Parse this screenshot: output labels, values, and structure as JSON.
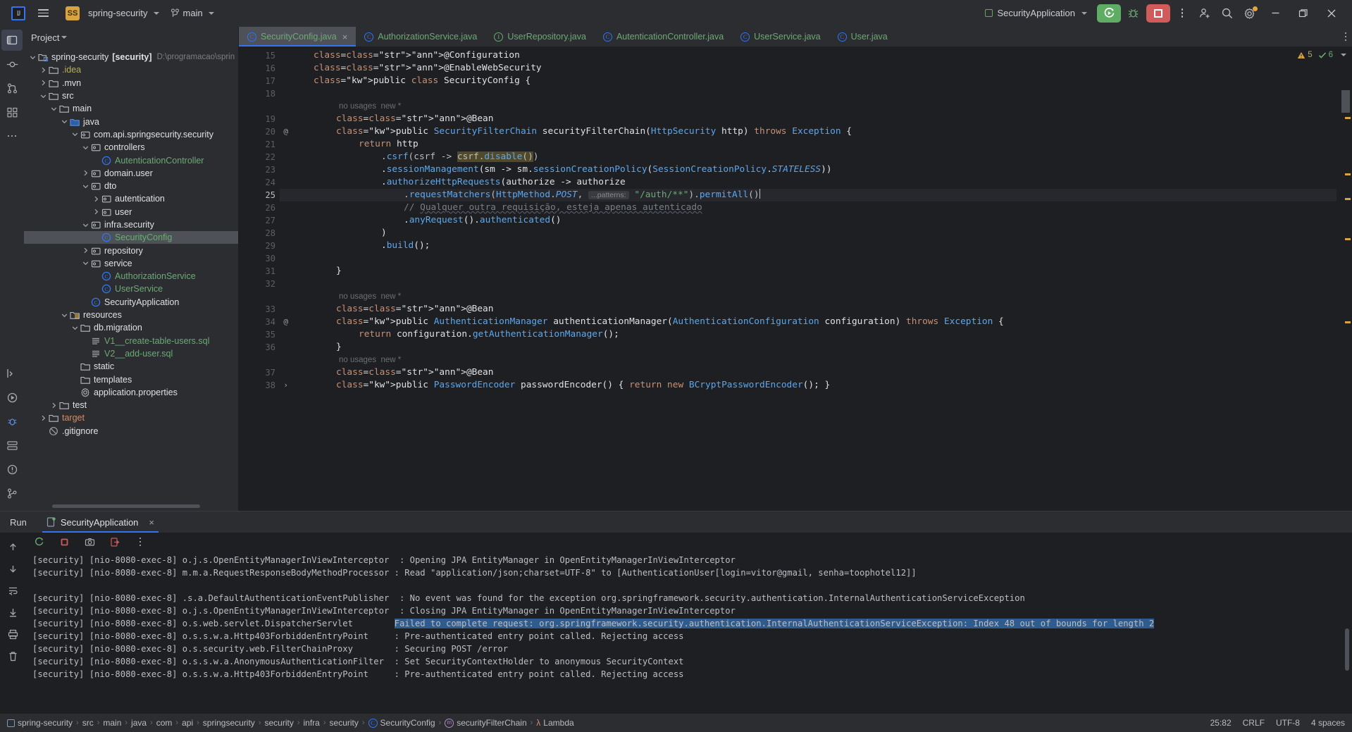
{
  "titlebar": {
    "logo": "IJ",
    "menu_icon": "hamburger-icon",
    "project_badge": "SS",
    "project_name": "spring-security",
    "branch_icon": "git-branch-icon",
    "branch_name": "main",
    "run_config": "SecurityApplication",
    "run_icon": "run-icon",
    "debug_icon": "debug-bug-icon",
    "stop_icon": "stop-icon",
    "more_icon": "more-vertical-icon",
    "account_icon": "add-account-icon",
    "search_icon": "search-icon",
    "settings_icon": "gear-icon",
    "minimize_icon": "minimize-icon",
    "maximize_icon": "maximize-icon",
    "close_icon": "close-icon"
  },
  "rail": {
    "top": [
      "project-icon",
      "commit-icon",
      "pull-requests-icon",
      "structure-icon",
      "more-tools-icon"
    ],
    "bottom": [
      "terminal-icon",
      "run-icon",
      "debug-icon",
      "services-icon",
      "problems-icon",
      "git-icon"
    ]
  },
  "project_panel": {
    "title": "Project",
    "tree": [
      {
        "depth": 0,
        "twist": "open",
        "icon": "module-icon",
        "label": "spring-security",
        "bold": "[security]",
        "path": "D:\\programacao\\sprin",
        "style": "plain"
      },
      {
        "depth": 1,
        "twist": "closed",
        "icon": "folder-icon",
        "label": ".idea",
        "style": "khaki"
      },
      {
        "depth": 1,
        "twist": "closed",
        "icon": "folder-icon",
        "label": ".mvn",
        "style": "plain"
      },
      {
        "depth": 1,
        "twist": "open",
        "icon": "folder-icon",
        "label": "src",
        "style": "plain"
      },
      {
        "depth": 2,
        "twist": "open",
        "icon": "folder-icon",
        "label": "main",
        "style": "plain"
      },
      {
        "depth": 3,
        "twist": "open",
        "icon": "source-folder-icon",
        "label": "java",
        "style": "plain"
      },
      {
        "depth": 4,
        "twist": "open",
        "icon": "package-icon",
        "label": "com.api.springsecurity.security",
        "style": "plain"
      },
      {
        "depth": 5,
        "twist": "open",
        "icon": "package-icon",
        "label": "controllers",
        "style": "plain"
      },
      {
        "depth": 6,
        "twist": "none",
        "icon": "java-class-icon",
        "label": "AutenticationController",
        "style": "green"
      },
      {
        "depth": 5,
        "twist": "closed",
        "icon": "package-icon",
        "label": "domain.user",
        "style": "plain"
      },
      {
        "depth": 5,
        "twist": "open",
        "icon": "package-icon",
        "label": "dto",
        "style": "plain"
      },
      {
        "depth": 6,
        "twist": "closed",
        "icon": "package-icon",
        "label": "autentication",
        "style": "plain"
      },
      {
        "depth": 6,
        "twist": "closed",
        "icon": "package-icon",
        "label": "user",
        "style": "plain"
      },
      {
        "depth": 5,
        "twist": "open",
        "icon": "package-icon",
        "label": "infra.security",
        "style": "plain"
      },
      {
        "depth": 6,
        "twist": "none",
        "icon": "java-class-icon",
        "label": "SecurityConfig",
        "style": "green",
        "selected": true
      },
      {
        "depth": 5,
        "twist": "closed",
        "icon": "package-icon",
        "label": "repository",
        "style": "plain"
      },
      {
        "depth": 5,
        "twist": "open",
        "icon": "package-icon",
        "label": "service",
        "style": "plain"
      },
      {
        "depth": 6,
        "twist": "none",
        "icon": "java-class-icon",
        "label": "AuthorizationService",
        "style": "green"
      },
      {
        "depth": 6,
        "twist": "none",
        "icon": "java-class-icon",
        "label": "UserService",
        "style": "green"
      },
      {
        "depth": 5,
        "twist": "none",
        "icon": "java-class-icon",
        "label": "SecurityApplication",
        "style": "plain"
      },
      {
        "depth": 3,
        "twist": "open",
        "icon": "resources-folder-icon",
        "label": "resources",
        "style": "plain"
      },
      {
        "depth": 4,
        "twist": "open",
        "icon": "folder-icon",
        "label": "db.migration",
        "style": "plain"
      },
      {
        "depth": 5,
        "twist": "none",
        "icon": "sql-file-icon",
        "label": "V1__create-table-users.sql",
        "style": "green"
      },
      {
        "depth": 5,
        "twist": "none",
        "icon": "sql-file-icon",
        "label": "V2__add-user.sql",
        "style": "green"
      },
      {
        "depth": 4,
        "twist": "none",
        "icon": "folder-icon",
        "label": "static",
        "style": "plain"
      },
      {
        "depth": 4,
        "twist": "none",
        "icon": "folder-icon",
        "label": "templates",
        "style": "plain"
      },
      {
        "depth": 4,
        "twist": "none",
        "icon": "properties-file-icon",
        "label": "application.properties",
        "style": "plain"
      },
      {
        "depth": 2,
        "twist": "closed",
        "icon": "folder-icon",
        "label": "test",
        "style": "plain"
      },
      {
        "depth": 1,
        "twist": "closed",
        "icon": "folder-icon",
        "label": "target",
        "style": "orange"
      },
      {
        "depth": 1,
        "twist": "none",
        "icon": "gitignore-icon",
        "label": ".gitignore",
        "style": "plain"
      }
    ]
  },
  "editor": {
    "tabs": [
      {
        "label": "SecurityConfig.java",
        "icon": "java-class-icon",
        "active": true,
        "closable": true
      },
      {
        "label": "AuthorizationService.java",
        "icon": "java-class-icon",
        "active": false
      },
      {
        "label": "UserRepository.java",
        "icon": "java-interface-icon",
        "active": false
      },
      {
        "label": "AutenticationController.java",
        "icon": "java-class-icon",
        "active": false
      },
      {
        "label": "UserService.java",
        "icon": "java-class-icon",
        "active": false
      },
      {
        "label": "User.java",
        "icon": "java-class-icon",
        "active": false
      }
    ],
    "more_tabs_icon": "more-vertical-icon",
    "analysis": {
      "warnings": "5",
      "ok": "6",
      "warn_icon": "warning-triangle-icon",
      "ok_icon": "checkmark-icon",
      "collapse_icon": "chevron-down-icon"
    },
    "lines": [
      {
        "num": "15",
        "text": "@Configuration"
      },
      {
        "num": "16",
        "text": "@EnableWebSecurity"
      },
      {
        "num": "17",
        "text": "public class SecurityConfig {"
      },
      {
        "num": "18",
        "text": ""
      },
      {
        "num": "",
        "text": "no usages  new *",
        "hint": true
      },
      {
        "num": "19",
        "text": "@Bean"
      },
      {
        "num": "20",
        "text": "public SecurityFilterChain securityFilterChain(HttpSecurity http) throws Exception {",
        "marker": "@"
      },
      {
        "num": "21",
        "text": "return http"
      },
      {
        "num": "22",
        "text": ".csrf(csrf -> csrf.disable())"
      },
      {
        "num": "23",
        "text": ".sessionManagement(sm -> sm.sessionCreationPolicy(SessionCreationPolicy.STATELESS))"
      },
      {
        "num": "24",
        "text": ".authorizeHttpRequests(authorize -> authorize"
      },
      {
        "num": "25",
        "text": ".requestMatchers(HttpMethod.POST,  ...patterns: \"/auth/**\").permitAll()",
        "highlight": true
      },
      {
        "num": "26",
        "text": "// Qualquer outra requisição, esteja apenas autenticado"
      },
      {
        "num": "27",
        "text": ".anyRequest().authenticated()"
      },
      {
        "num": "28",
        "text": ")"
      },
      {
        "num": "29",
        "text": ".build();"
      },
      {
        "num": "30",
        "text": ""
      },
      {
        "num": "31",
        "text": "}"
      },
      {
        "num": "32",
        "text": ""
      },
      {
        "num": "",
        "text": "no usages  new *",
        "hint": true
      },
      {
        "num": "33",
        "text": "@Bean"
      },
      {
        "num": "34",
        "text": "public AuthenticationManager authenticationManager(AuthenticationConfiguration configuration) throws Exception {",
        "marker": "@"
      },
      {
        "num": "35",
        "text": "return configuration.getAuthenticationManager();"
      },
      {
        "num": "36",
        "text": "}"
      },
      {
        "num": "",
        "text": "no usages  new *",
        "hint": true
      },
      {
        "num": "37",
        "text": "@Bean"
      },
      {
        "num": "38",
        "text": "public PasswordEncoder passwordEncoder() { return new BCryptPasswordEncoder(); }",
        "fold": true
      }
    ],
    "param_hint": "...patterns:"
  },
  "run_panel": {
    "tab_run": "Run",
    "tab_config": "SecurityApplication",
    "config_icon": "spring-boot-icon",
    "close_icon": "close-icon",
    "tools": [
      "rerun-icon",
      "stop-icon",
      "camera-icon",
      "export-icon",
      "more-vertical-icon"
    ],
    "side_tools": [
      "up-arrow-icon",
      "down-arrow-icon",
      "soft-wrap-icon",
      "scroll-end-icon",
      "print-icon",
      "trash-icon"
    ],
    "logs": [
      {
        "text": "[security] [nio-8080-exec-8] o.j.s.OpenEntityManagerInViewInterceptor  : Opening JPA EntityManager in OpenEntityManagerInViewInterceptor"
      },
      {
        "text": "[security] [nio-8080-exec-8] m.m.a.RequestResponseBodyMethodProcessor : Read \"application/json;charset=UTF-8\" to [AuthenticationUser[login=vitor@gmail, senha=toophotel12]]"
      },
      {
        "text": ""
      },
      {
        "text": "[security] [nio-8080-exec-8] .s.a.DefaultAuthenticationEventPublisher  : No event was found for the exception org.springframework.security.authentication.InternalAuthenticationServiceException"
      },
      {
        "text": "[security] [nio-8080-exec-8] o.j.s.OpenEntityManagerInViewInterceptor  : Closing JPA EntityManager in OpenEntityManagerInViewInterceptor"
      },
      {
        "prefix": "[security] [nio-8080-exec-8] o.s.web.servlet.DispatcherServlet        ",
        "selected": "Failed to complete request: org.springframework.security.authentication.InternalAuthenticationServiceException: Index 48 out of bounds for length 2"
      },
      {
        "text": "[security] [nio-8080-exec-8] o.s.s.w.a.Http403ForbiddenEntryPoint     : Pre-authenticated entry point called. Rejecting access"
      },
      {
        "text": "[security] [nio-8080-exec-8] o.s.security.web.FilterChainProxy        : Securing POST /error"
      },
      {
        "text": "[security] [nio-8080-exec-8] o.s.s.w.a.AnonymousAuthenticationFilter  : Set SecurityContextHolder to anonymous SecurityContext"
      },
      {
        "text": "[security] [nio-8080-exec-8] o.s.s.w.a.Http403ForbiddenEntryPoint     : Pre-authenticated entry point called. Rejecting access"
      }
    ]
  },
  "status_bar": {
    "breadcrumbs": [
      {
        "label": "spring-security",
        "icon": "module-icon"
      },
      {
        "label": "src"
      },
      {
        "label": "main"
      },
      {
        "label": "java"
      },
      {
        "label": "com"
      },
      {
        "label": "api"
      },
      {
        "label": "springsecurity"
      },
      {
        "label": "security"
      },
      {
        "label": "infra"
      },
      {
        "label": "security"
      },
      {
        "label": "SecurityConfig",
        "icon": "java-class-icon"
      },
      {
        "label": "securityFilterChain",
        "icon": "method-icon"
      },
      {
        "label": "Lambda",
        "icon": "lambda-icon"
      }
    ],
    "position": "25:82",
    "line_sep": "CRLF",
    "encoding": "UTF-8",
    "indent": "4 spaces"
  },
  "colors": {
    "accent": "#3574f0",
    "run_green": "#5fad65",
    "stop_red": "#d15a5a",
    "badge_gold": "#d9a343",
    "selection_blue": "#2f5c8f"
  }
}
